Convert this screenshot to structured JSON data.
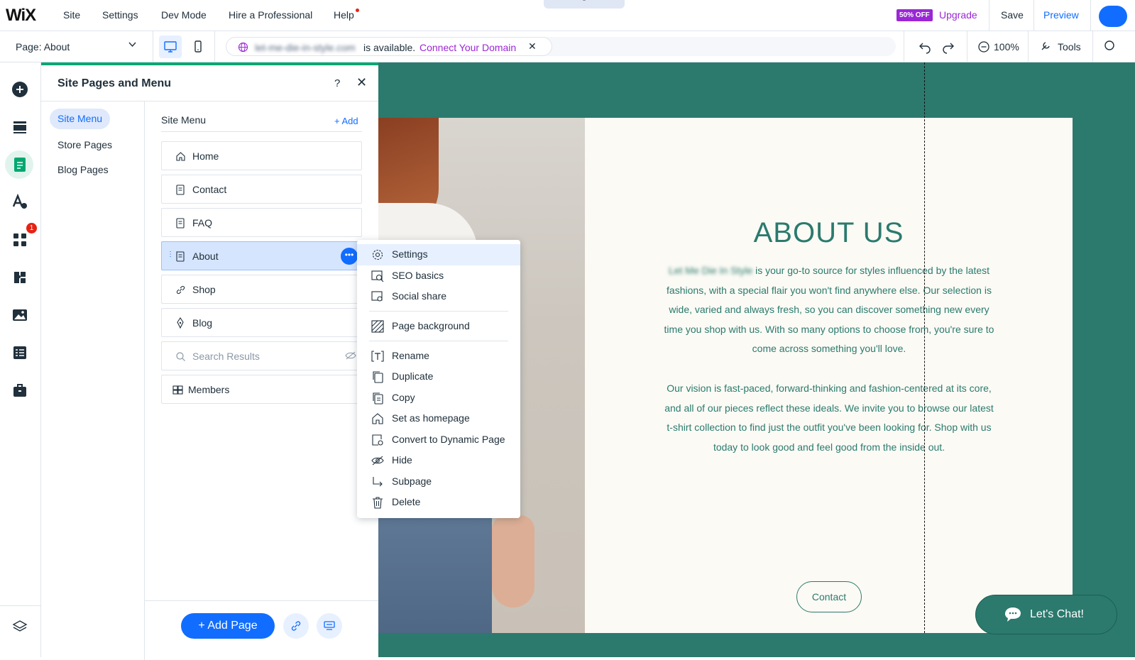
{
  "topbar": {
    "logo": "WiX",
    "nav": [
      "Site",
      "Settings",
      "Dev Mode",
      "Hire a Professional",
      "Help"
    ],
    "sale_badge": "50% OFF",
    "upgrade": "Upgrade",
    "save": "Save",
    "preview": "Preview"
  },
  "secondbar": {
    "page_select": "Page: About",
    "domain_name": "let-me-die-in-style.com",
    "domain_available": "is available.",
    "connect_domain": "Connect Your Domain",
    "zoom": "100%",
    "tools": "Tools"
  },
  "panel": {
    "title": "Site Pages and Menu",
    "help": "?",
    "categories": [
      "Site Menu",
      "Store Pages",
      "Blog Pages"
    ],
    "menu_heading": "Site Menu",
    "add": "+ Add",
    "pages": [
      "Home",
      "Contact",
      "FAQ",
      "About",
      "Shop",
      "Blog",
      "Search Results",
      "Members"
    ],
    "add_page_button": "+ Add Page"
  },
  "context_menu": {
    "items": [
      "Settings",
      "SEO basics",
      "Social share",
      "Page background",
      "Rename",
      "Duplicate",
      "Copy",
      "Set as homepage",
      "Convert to Dynamic Page",
      "Hide",
      "Subpage",
      "Delete"
    ]
  },
  "canvas": {
    "heading": "ABOUT US",
    "site_name": "Let Me Die In Style",
    "para1_rest": " is your go-to source for styles influenced by the latest fashions, with a special flair you won't find anywhere else. Our selection is wide, varied and always fresh, so you can discover something new every time you shop with us. With so many options to choose from, you're sure to come across something you'll love.",
    "para2": "Our vision is fast-paced, forward-thinking and fashion-centered at its core, and all of our pieces reflect these ideals. We invite you to browse our latest t-shirt collection to find just the outfit you've been looking for. Shop with us today to look good and feel good from the inside out.",
    "contact_button": "Contact",
    "chat_button": "Let's Chat!"
  },
  "badges": {
    "apps_count": "1"
  },
  "colors": {
    "accent": "#116dff",
    "brand_green": "#2b7a6d",
    "upgrade_purple": "#9a27d5"
  }
}
